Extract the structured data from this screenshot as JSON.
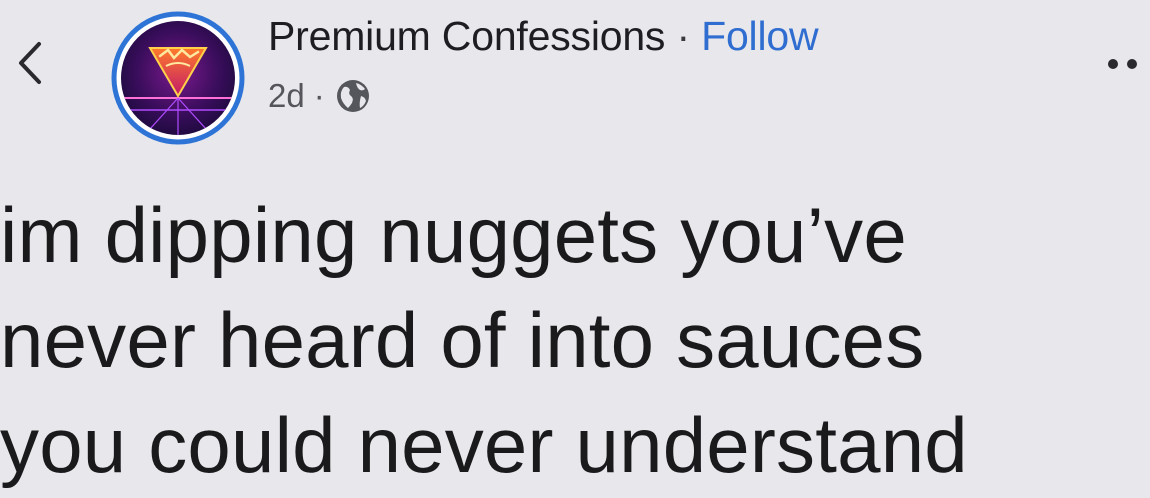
{
  "header": {
    "author": "Premium Confessions",
    "separator": "·",
    "follow_label": "Follow",
    "timestamp": "2d",
    "meta_separator": "·",
    "privacy_icon": "globe-icon",
    "back_icon": "chevron-left-icon",
    "more_icon": "more-dots-icon"
  },
  "post": {
    "lines": [
      "im dipping nuggets you’ve",
      "never heard of into sauces",
      "you could never understand"
    ]
  },
  "colors": {
    "background": "#e8e8ec",
    "follow_link": "#2f6ed0",
    "avatar_ring": "#2e74d6"
  }
}
